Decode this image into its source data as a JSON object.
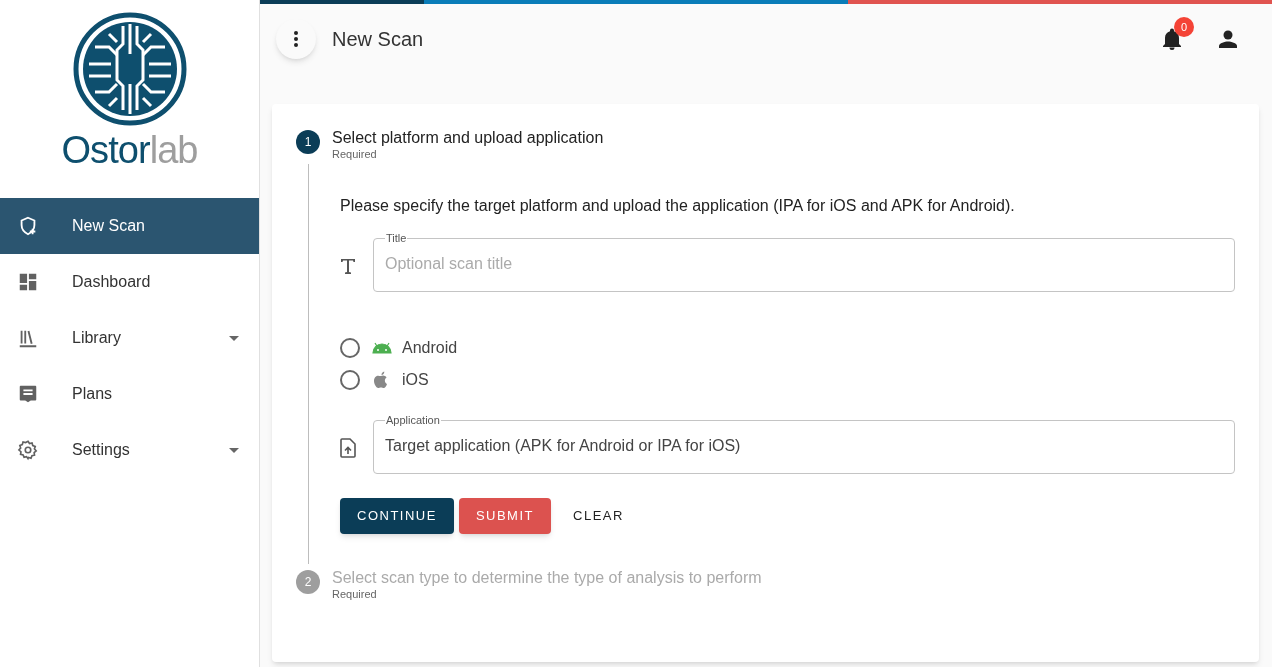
{
  "logo": {
    "parts": [
      "Ostor",
      "lab"
    ]
  },
  "sidebar": {
    "items": [
      {
        "label": "New Scan",
        "selected": true,
        "expandable": false
      },
      {
        "label": "Dashboard",
        "selected": false,
        "expandable": false
      },
      {
        "label": "Library",
        "selected": false,
        "expandable": true
      },
      {
        "label": "Plans",
        "selected": false,
        "expandable": false
      },
      {
        "label": "Settings",
        "selected": false,
        "expandable": true
      }
    ]
  },
  "header": {
    "title": "New Scan",
    "notifications": {
      "count": "0"
    }
  },
  "steps": [
    {
      "number": "1",
      "label": "Select platform and upload application",
      "sublabel": "Required",
      "active": true,
      "description": "Please specify the target platform and upload the application (IPA for iOS and APK for Android).",
      "title_field": {
        "label": "Title",
        "placeholder": "Optional scan title"
      },
      "platforms": [
        {
          "label": "Android",
          "kind": "android",
          "selected": false
        },
        {
          "label": "iOS",
          "kind": "ios",
          "selected": false
        }
      ],
      "application_field": {
        "label": "Application",
        "value": "Target application (APK for Android or IPA for iOS)"
      },
      "buttons": [
        {
          "label": "CONTINUE",
          "kind": "primary"
        },
        {
          "label": "SUBMIT",
          "kind": "danger"
        },
        {
          "label": "CLEAR",
          "kind": "text"
        }
      ]
    },
    {
      "number": "2",
      "label": "Select scan type to determine the type of analysis to perform",
      "sublabel": "Required",
      "active": false
    }
  ]
}
